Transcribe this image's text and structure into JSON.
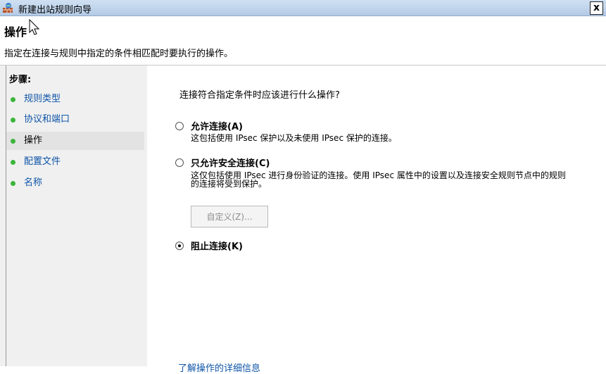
{
  "window": {
    "title": "新建出站规则向导",
    "close_label": "x"
  },
  "header": {
    "title": "操作",
    "description": "指定在连接与规则中指定的条件相匹配时要执行的操作。"
  },
  "steps": {
    "title": "步骤:",
    "items": [
      {
        "label": "规则类型",
        "active": false
      },
      {
        "label": "协议和端口",
        "active": false
      },
      {
        "label": "操作",
        "active": true
      },
      {
        "label": "配置文件",
        "active": false
      },
      {
        "label": "名称",
        "active": false
      }
    ]
  },
  "main": {
    "question": "连接符合指定条件时应该进行什么操作?",
    "options": [
      {
        "label": "允许连接(A)",
        "description": "这包括使用 IPsec 保护以及未使用 IPsec 保护的连接。",
        "selected": false
      },
      {
        "label": "只允许安全连接(C)",
        "description": "这仅包括使用 IPsec 进行身份验证的连接。使用 IPsec 属性中的设置以及连接安全规则节点中的规则的连接将受到保护。",
        "selected": false
      },
      {
        "label": "阻止连接(K)",
        "selected": true
      }
    ],
    "customize_button": "自定义(Z)...",
    "bottom_link": "了解操作的详细信息"
  },
  "colors": {
    "link": "#0f55a8",
    "step_dot": "#3bb53b",
    "titlebar": "#cfe0f2"
  }
}
